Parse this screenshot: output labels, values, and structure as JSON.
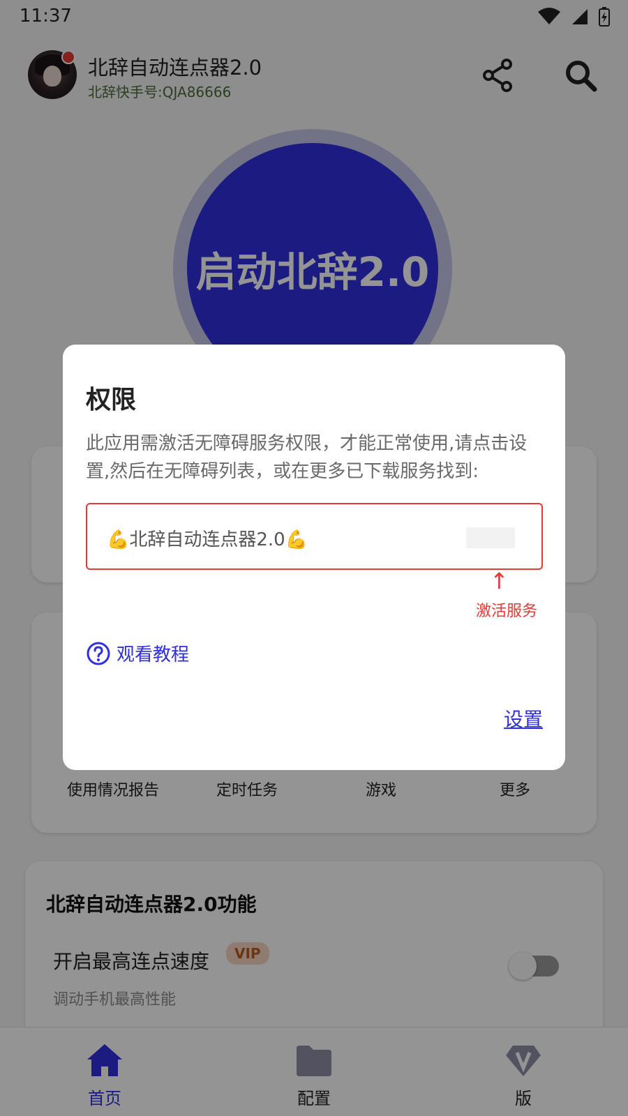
{
  "status_bar": {
    "time": "11:37"
  },
  "header": {
    "title": "北辞自动连点器2.0",
    "subtitle": "北辞快手号:QJA86666"
  },
  "start_button": {
    "label": "启动北辞2.0"
  },
  "tools_grid": [
    {
      "label": "使用情况报告"
    },
    {
      "label": "定时任务"
    },
    {
      "label": "游戏"
    },
    {
      "label": "更多"
    }
  ],
  "features": {
    "title": "北辞自动连点器2.0功能",
    "items": [
      {
        "name": "开启最高连点速度",
        "badge": "VIP",
        "desc": "调动手机最高性能",
        "enabled": false
      }
    ]
  },
  "bottom_nav": [
    {
      "label": "首页",
      "icon": "home-icon",
      "active": true
    },
    {
      "label": "配置",
      "icon": "folder-icon",
      "active": false
    },
    {
      "label": "版",
      "icon": "vip-diamond-icon",
      "active": false
    }
  ],
  "dialog": {
    "title": "权限",
    "message": "此应用需激活无障碍服务权限，才能正常使用,请点击设置,然后在无障碍列表，或在更多已下载服务找到:",
    "service_name": "💪北辞自动连点器2.0💪",
    "hint_arrow": "↑",
    "hint_text": "激活服务",
    "tutorial_link": "观看教程",
    "confirm_button": "设置"
  },
  "colors": {
    "accent": "#2f2fe0",
    "warning": "#e53935",
    "vip_badge_bg": "#f6d5bf",
    "vip_badge_text": "#b85a25"
  }
}
